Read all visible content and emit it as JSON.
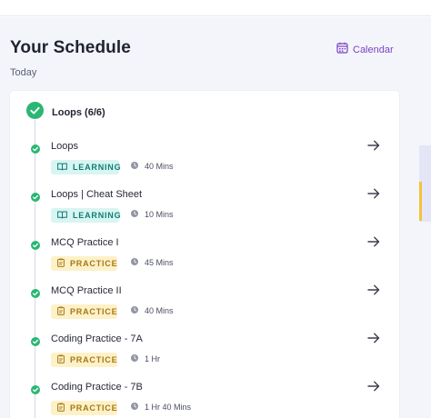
{
  "header": {
    "title": "Your Schedule",
    "subtitle": "Today",
    "calendar_label": "Calendar",
    "accent": "#7a42c4"
  },
  "group": {
    "label": "Loops (6/6)",
    "status_color": "#2bb673"
  },
  "items": [
    {
      "title": "Loops",
      "type": "LEARNING",
      "duration": "40 Mins",
      "icon": "book-icon"
    },
    {
      "title": "Loops | Cheat Sheet",
      "type": "LEARNING",
      "duration": "10 Mins",
      "icon": "book-icon"
    },
    {
      "title": "MCQ Practice I",
      "type": "PRACTICE",
      "duration": "45 Mins",
      "icon": "clipboard-icon"
    },
    {
      "title": "MCQ Practice II",
      "type": "PRACTICE",
      "duration": "40 Mins",
      "icon": "clipboard-icon"
    },
    {
      "title": "Coding Practice - 7A",
      "type": "PRACTICE",
      "duration": "1 Hr",
      "icon": "clipboard-icon"
    },
    {
      "title": "Coding Practice - 7B",
      "type": "PRACTICE",
      "duration": "1 Hr 40 Mins",
      "icon": "clipboard-icon"
    }
  ],
  "colors": {
    "learning_bg": "#d8f5f1",
    "learning_text": "#0f7c77",
    "practice_bg": "#fdf1c9",
    "practice_text": "#a87812",
    "scroll_thumb": "#f2c33a"
  }
}
